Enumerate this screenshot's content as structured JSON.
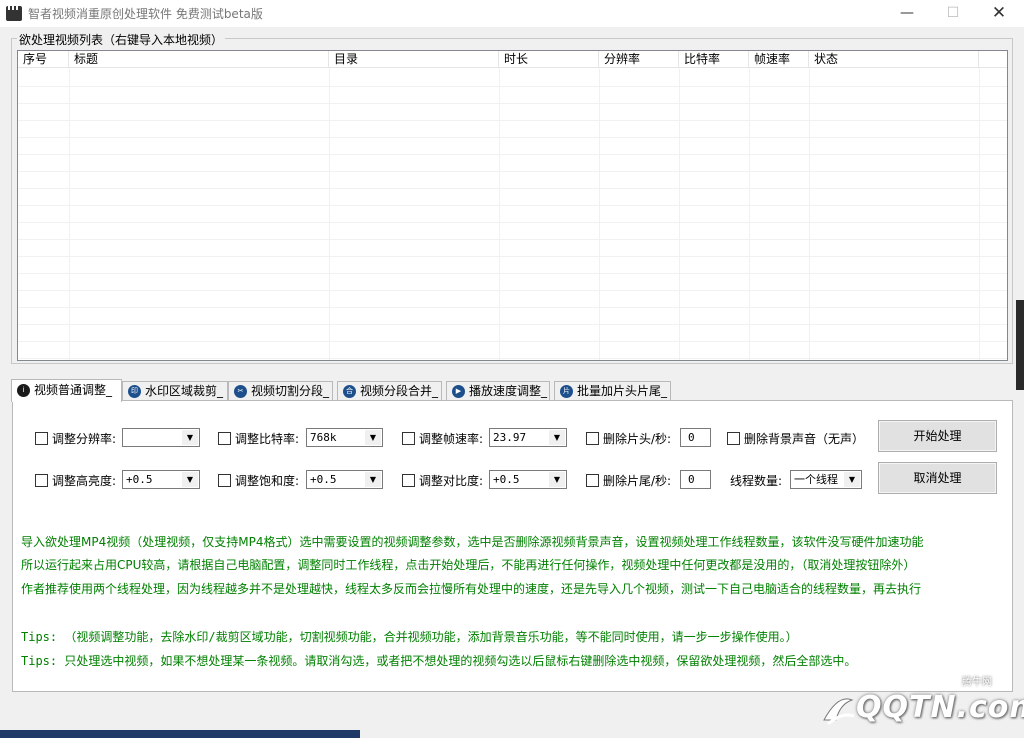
{
  "window": {
    "title": "智者视频消重原创处理软件 免费测试beta版",
    "min_symbol": "—",
    "max_symbol": "☐",
    "close_symbol": "✕"
  },
  "list": {
    "group_title": "欲处理视频列表（右键导入本地视频）",
    "columns": [
      "序号",
      "标题",
      "目录",
      "时长",
      "分辨率",
      "比特率",
      "帧速率",
      "状态"
    ]
  },
  "tabs": [
    {
      "label": "视频普通调整_",
      "icon": "info-icon"
    },
    {
      "label": "水印区域裁剪_",
      "icon": "watermark-icon"
    },
    {
      "label": "视频切割分段_",
      "icon": "cut-icon"
    },
    {
      "label": "视频分段合并_",
      "icon": "merge-icon"
    },
    {
      "label": "播放速度调整_",
      "icon": "speed-icon"
    },
    {
      "label": "批量加片头片尾_",
      "icon": "clip-icon"
    }
  ],
  "settings": {
    "resolution_label": "调整分辨率:",
    "resolution_value": "",
    "bitrate_label": "调整比特率:",
    "bitrate_value": "768k",
    "framerate_label": "调整帧速率:",
    "framerate_value": "23.97",
    "cut_head_label": "删除片头/秒:",
    "cut_head_value": "0",
    "remove_audio_label": "删除背景声音（无声）",
    "brightness_label": "调整高亮度:",
    "brightness_value": "+0.5",
    "saturation_label": "调整饱和度:",
    "saturation_value": "+0.5",
    "contrast_label": "调整对比度:",
    "contrast_value": "+0.5",
    "cut_tail_label": "删除片尾/秒:",
    "cut_tail_value": "0",
    "threads_label": "线程数量:",
    "threads_value": "一个线程",
    "start_button": "开始处理",
    "cancel_button": "取消处理"
  },
  "info": {
    "line1": "导入欲处理MP4视频（处理视频，仅支持MP4格式）选中需要设置的视频调整参数，选中是否删除源视频背景声音，设置视频处理工作线程数量，该软件没写硬件加速功能",
    "line2": "所以运行起来占用CPU较高，请根据自己电脑配置，调整同时工作线程，点击开始处理后，不能再进行任何操作，视频处理中任何更改都是没用的，（取消处理按钮除外）",
    "line3": "作者推荐使用两个线程处理，因为线程越多并不是处理越快，线程太多反而会拉慢所有处理中的速度，还是先导入几个视频，测试一下自己电脑适合的线程数量，再去执行",
    "tip1": "Tips: （视频调整功能，去除水印/裁剪区域功能，切割视频功能，合并视频功能，添加背景音乐功能，等不能同时使用，请一步一步操作使用。）",
    "tip2": "Tips:  只处理选中视频，如果不想处理某一条视频。请取消勾选，或者把不想处理的视频勾选以后鼠标右键删除选中视频，保留欲处理视频，然后全部选中。"
  },
  "watermark": {
    "small": "腾牛网",
    "logo": "QQTN.com"
  },
  "colors": {
    "info_text": "#008000",
    "list_border": "#828790"
  }
}
